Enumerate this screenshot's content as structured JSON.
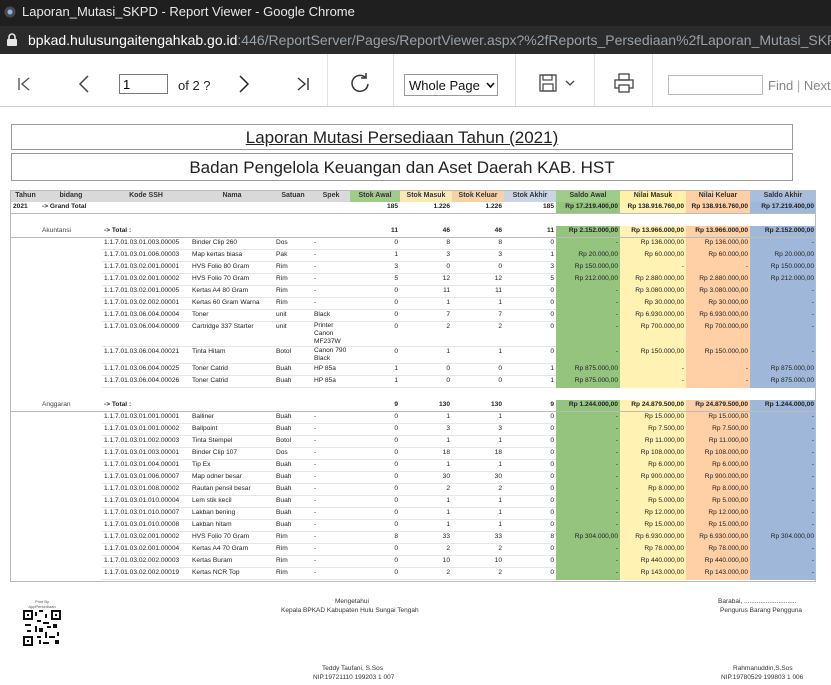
{
  "window": {
    "title": "Laporan_Mutasi_SKPD - Report Viewer - Google Chrome",
    "url_host": "bpkad.hulusungaitengahkab.go.id",
    "url_rest": ":446/ReportServer/Pages/ReportViewer.aspx?%2fReports_Persediaan%2fLaporan_Mutasi_SKPD&"
  },
  "toolbar": {
    "page_value": "1",
    "of_text": "of 2 ?",
    "zoom_value": "Whole Page",
    "find_label": "Find",
    "next_label": "Next"
  },
  "report": {
    "title": "Laporan Mutasi Persediaan Tahun (2021)",
    "subtitle": "Badan Pengelola Keuangan dan Aset Daerah KAB. HST",
    "headers": [
      "Tahun",
      "bidang",
      "Kode SSH",
      "Nama",
      "Satuan",
      "Spek",
      "Stok Awal",
      "Stok Masuk",
      "Stok Keluar",
      "Stok Akhir",
      "Saldo Awal",
      "Nilai Masuk",
      "Nilai Keluar",
      "Saldo Akhir"
    ],
    "grand": {
      "tahun": "2021",
      "label": "-> Grand Total",
      "stok_awal": "185",
      "stok_masuk": "1.226",
      "stok_keluar": "1.226",
      "stok_akhir": "185",
      "saldo_awal": "Rp 17.219.400,00",
      "nilai_masuk": "Rp 138.916.760,00",
      "nilai_keluar": "Rp 138.916.760,00",
      "saldo_akhir": "Rp 17.219.400,00"
    },
    "groups": [
      {
        "bidang": "Akuntansi",
        "total_label": "-> Total :",
        "total": {
          "stok_awal": "11",
          "stok_masuk": "46",
          "stok_keluar": "46",
          "stok_akhir": "11",
          "saldo_awal": "Rp 2.152.000,00",
          "nilai_masuk": "Rp 13.966.000,00",
          "nilai_keluar": "Rp 13.966.000,00",
          "saldo_akhir": "Rp 2.152.000,00"
        },
        "rows": [
          [
            "1.1.7.01.03.01.003.00005",
            "Binder Clip 260",
            "Dos",
            "-",
            "0",
            "8",
            "8",
            "0",
            "-",
            "Rp 136.000,00",
            "Rp 136.000,00",
            "-"
          ],
          [
            "1.1.7.01.03.01.006.00003",
            "Map kertas biasa",
            "Pak",
            "-",
            "1",
            "3",
            "3",
            "1",
            "Rp 20.000,00",
            "Rp 60.000,00",
            "Rp 60.000,00",
            "Rp 20.000,00"
          ],
          [
            "1.1.7.01.03.02.001.00001",
            "HVS Folio 80 Gram",
            "Rim",
            "-",
            "3",
            "0",
            "0",
            "3",
            "Rp 150.000,00",
            "-",
            "-",
            "Rp 150.000,00"
          ],
          [
            "1.1.7.01.03.02.001.00002",
            "HVS Folio 70 Gram",
            "Rim",
            "-",
            "5",
            "12",
            "12",
            "5",
            "Rp 212.000,00",
            "Rp 2.880.000,00",
            "Rp 2.880.000,00",
            "Rp 212.000,00"
          ],
          [
            "1.1.7.01.03.02.001.00005",
            "Kertas A4 80 Gram",
            "Rim",
            "-",
            "0",
            "11",
            "11",
            "0",
            "-",
            "Rp 3.080.000,00",
            "Rp 3.080.000,00",
            "-"
          ],
          [
            "1.1.7.01.03.02.002.00001",
            "Kertas 60 Gram Warna",
            "Rim",
            "-",
            "0",
            "1",
            "1",
            "0",
            "-",
            "Rp 30.000,00",
            "Rp 30.000,00",
            "-"
          ],
          [
            "1.1.7.01.03.06.004.00004",
            "Toner",
            "unit",
            "Black",
            "0",
            "7",
            "7",
            "0",
            "-",
            "Rp 6.930.000,00",
            "Rp 6.930.000,00",
            "-"
          ],
          [
            "1.1.7.01.03.06.004.00009",
            "Cartridge 337 Starter",
            "unit",
            "Printer Canon MF237W",
            "0",
            "2",
            "2",
            "0",
            "-",
            "Rp 700.000,00",
            "Rp 700.000,00",
            "-"
          ],
          [
            "1.1.7.01.03.06.004.00021",
            "Tinta Hitam",
            "Botol",
            "Canon 790 Black",
            "0",
            "1",
            "1",
            "0",
            "-",
            "Rp 150.000,00",
            "Rp 150.000,00",
            "-"
          ],
          [
            "1.1.7.01.03.06.004.00025",
            "Toner Catrid",
            "Buah",
            "HP 85a",
            "1",
            "0",
            "0",
            "1",
            "Rp 875.000,00",
            "-",
            "-",
            "Rp 875.000,00"
          ],
          [
            "1.1.7.01.03.06.004.00026",
            "Toner Catrid",
            "Buah",
            "HP 85a",
            "1",
            "0",
            "0",
            "1",
            "Rp 875.000,00",
            "-",
            "-",
            "Rp 875.000,00"
          ]
        ]
      },
      {
        "bidang": "Anggaran",
        "total_label": "-> Total :",
        "total": {
          "stok_awal": "9",
          "stok_masuk": "130",
          "stok_keluar": "130",
          "stok_akhir": "9",
          "saldo_awal": "Rp 1.244.000,00",
          "nilai_masuk": "Rp 24.879.500,00",
          "nilai_keluar": "Rp 24.879.500,00",
          "saldo_akhir": "Rp 1.244.000,00"
        },
        "rows": [
          [
            "1.1.7.01.03.01.001.00001",
            "Balliner",
            "Buah",
            "-",
            "0",
            "1",
            "1",
            "0",
            "-",
            "Rp 15.000,00",
            "Rp 15.000,00",
            "-"
          ],
          [
            "1.1.7.01.03.01.001.00002",
            "Ballpoint",
            "Buah",
            "-",
            "0",
            "3",
            "3",
            "0",
            "-",
            "Rp 7.500,00",
            "Rp 7.500,00",
            "-"
          ],
          [
            "1.1.7.01.03.01.002.00003",
            "Tinta Stempel",
            "Botol",
            "-",
            "0",
            "1",
            "1",
            "0",
            "-",
            "Rp 11.000,00",
            "Rp 11.000,00",
            "-"
          ],
          [
            "1.1.7.01.03.01.003.00001",
            "Binder Clip 107",
            "Dos",
            "-",
            "0",
            "18",
            "18",
            "0",
            "-",
            "Rp 108.000,00",
            "Rp 108.000,00",
            "-"
          ],
          [
            "1.1.7.01.03.01.004.00001",
            "Tip Ex",
            "Buah",
            "-",
            "0",
            "1",
            "1",
            "0",
            "-",
            "Rp 6.000,00",
            "Rp 6.000,00",
            "-"
          ],
          [
            "1.1.7.01.03.01.006.00007",
            "Map odner besar",
            "Buah",
            "-",
            "0",
            "30",
            "30",
            "0",
            "-",
            "Rp 900.000,00",
            "Rp 900.000,00",
            "-"
          ],
          [
            "1.1.7.01.03.01.008.00002",
            "Rautan pensil besar",
            "Buah",
            "-",
            "0",
            "2",
            "2",
            "0",
            "-",
            "Rp 8.000,00",
            "Rp 8.000,00",
            "-"
          ],
          [
            "1.1.7.01.03.01.010.00004",
            "Lem stik kecil",
            "Buah",
            "-",
            "0",
            "1",
            "1",
            "0",
            "-",
            "Rp 5.000,00",
            "Rp 5.000,00",
            "-"
          ],
          [
            "1.1.7.01.03.01.010.00007",
            "Lakban bening",
            "Buah",
            "-",
            "0",
            "1",
            "1",
            "0",
            "-",
            "Rp 12.000,00",
            "Rp 12.000,00",
            "-"
          ],
          [
            "1.1.7.01.03.01.010.00008",
            "Lakban hitam",
            "Buah",
            "-",
            "0",
            "1",
            "1",
            "0",
            "-",
            "Rp 15.000,00",
            "Rp 15.000,00",
            "-"
          ],
          [
            "1.1.7.01.03.02.001.00002",
            "HVS Folio 70 Gram",
            "Rim",
            "-",
            "8",
            "33",
            "33",
            "8",
            "Rp 304.000,00",
            "Rp 6.930.000,00",
            "Rp 6.930.000,00",
            "Rp 304.000,00"
          ],
          [
            "1.1.7.01.03.02.001.00004",
            "Kertas A4 70 Gram",
            "Rim",
            "-",
            "0",
            "2",
            "2",
            "0",
            "-",
            "Rp 78.000,00",
            "Rp 78.000,00",
            "-"
          ],
          [
            "1.1.7.01.03.02.002.00003",
            "Kertas Buram",
            "Rim",
            "-",
            "0",
            "10",
            "10",
            "0",
            "-",
            "Rp 440.000,00",
            "Rp 440.000,00",
            "-"
          ],
          [
            "1.1.7.01.03.02.002.00019",
            "Kertas NCR Top",
            "Rim",
            "-",
            "0",
            "2",
            "2",
            "0",
            "-",
            "Rp 143.000,00",
            "Rp 143.000,00",
            "-"
          ]
        ]
      }
    ]
  },
  "footer": {
    "printed_by": "Print By AppPersediaan BPKAD HST",
    "mengetahui": "Mengetahui",
    "kepala": "Kepala BPKAD Kabupaten Hulu Sungai Tengah",
    "barabai": "Barabai, .............................",
    "pengurus": "Pengurus Barang Pengguna",
    "sign1_name": "Teddy Taufani, S.Sos",
    "sign1_nip": "NIP.19721110 199203 1 007",
    "sign2_name": "Rahmanuddin,S.Sos",
    "sign2_nip": "NIP.19780529 199803 1 006"
  },
  "colors": {
    "saldo_awal": "#95c47e",
    "nilai_masuk": "#fff2b3",
    "nilai_keluar": "#ffcfa6",
    "saldo_akhir": "#9fb8d9"
  }
}
